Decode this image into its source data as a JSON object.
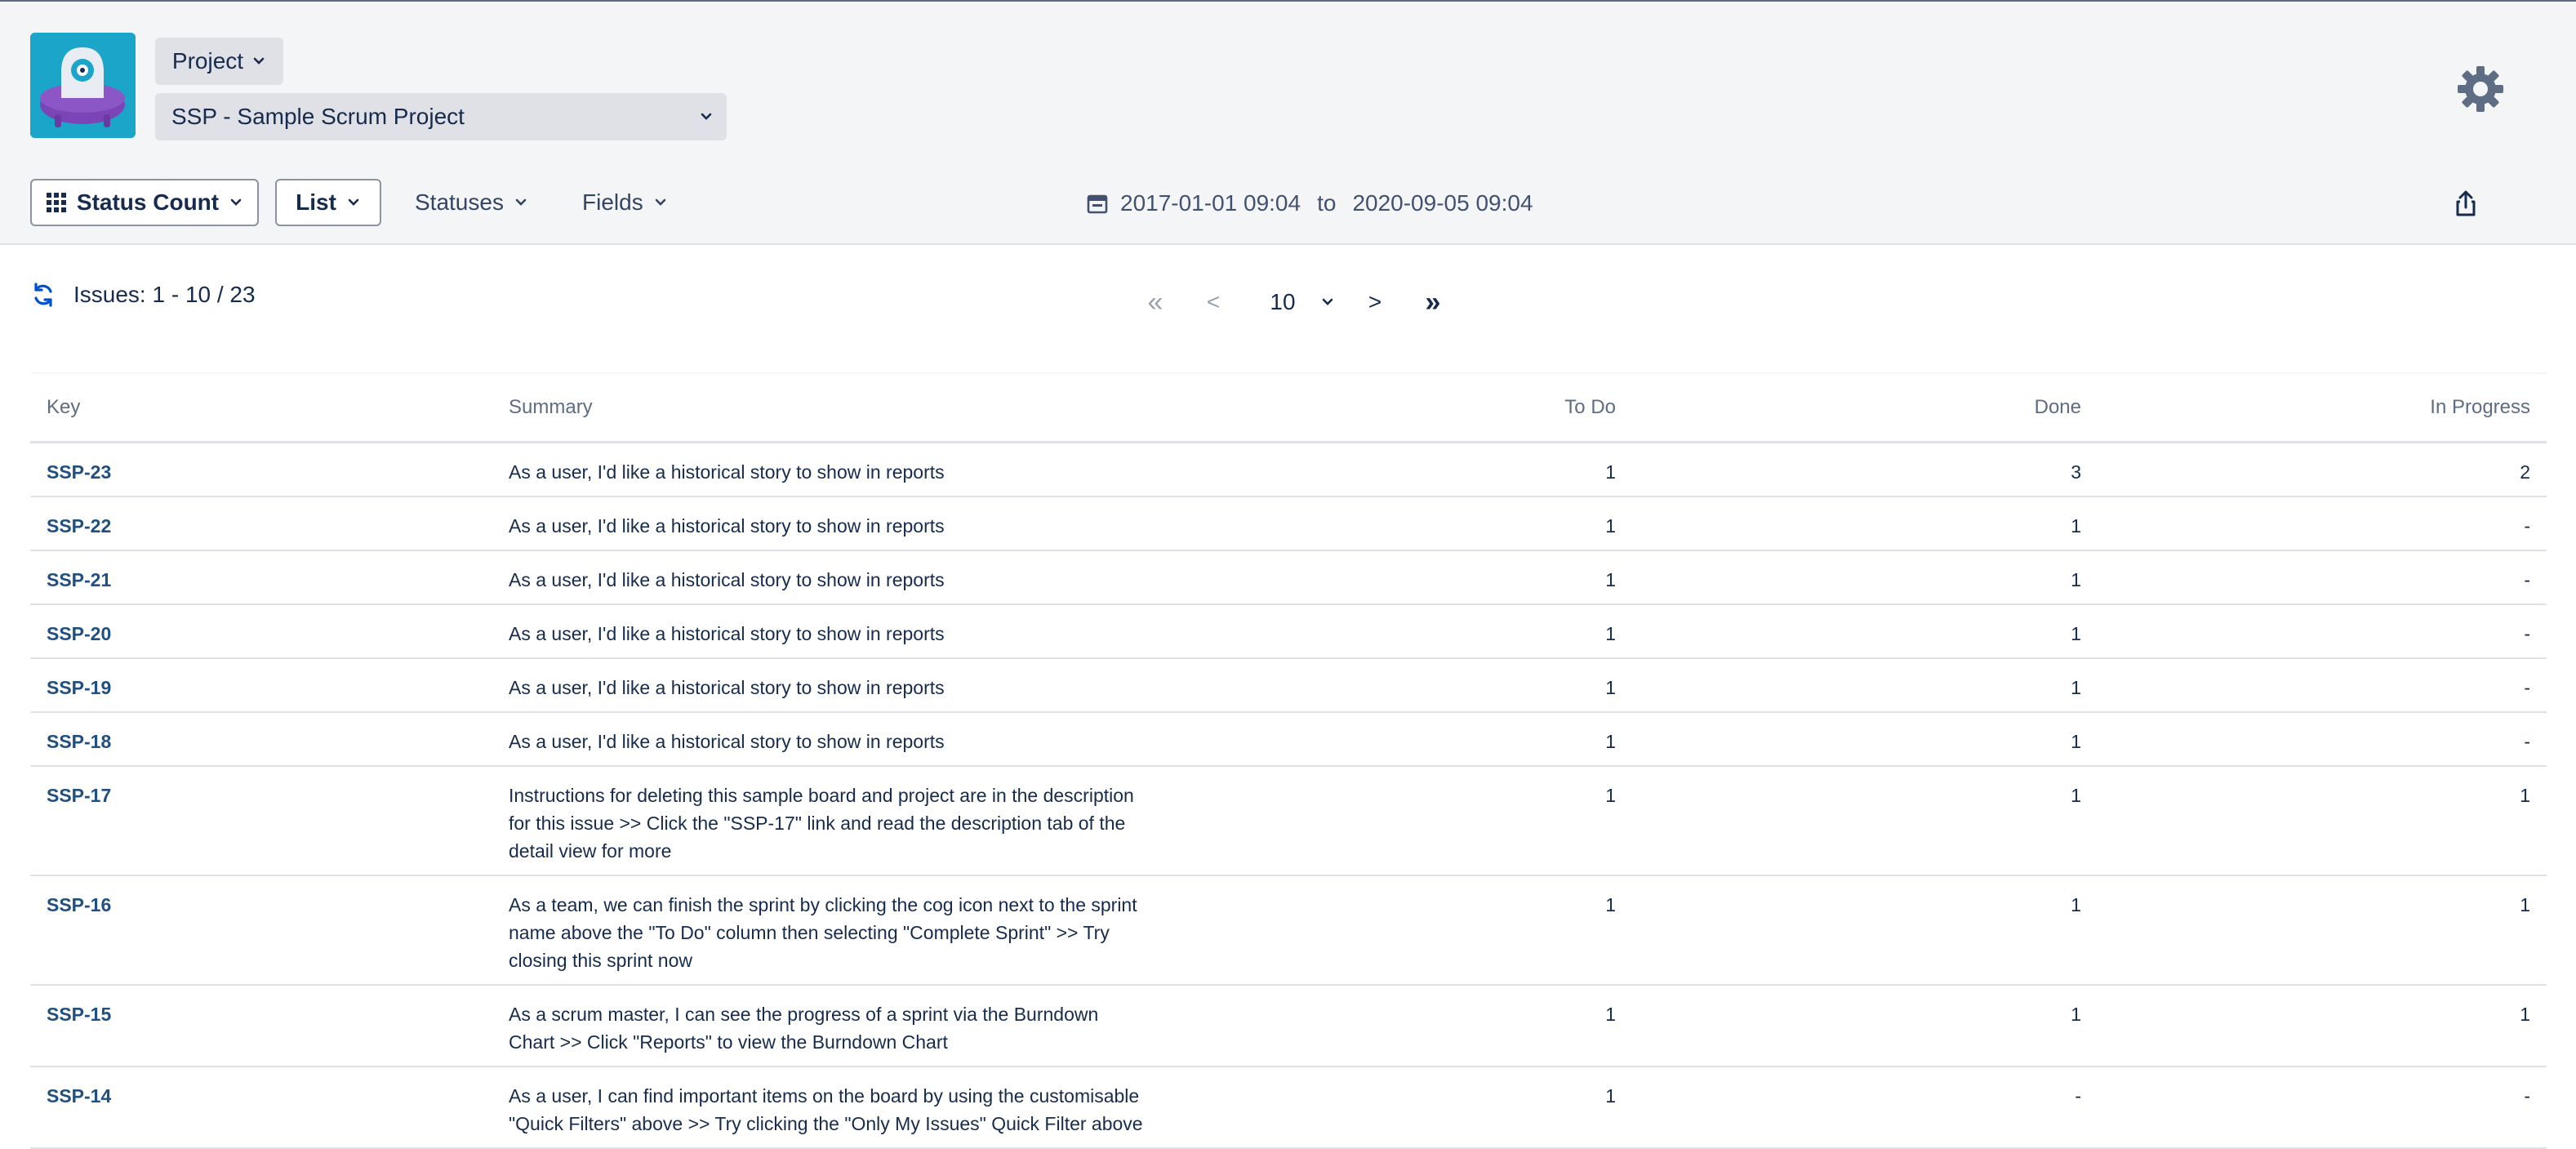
{
  "header": {
    "project_type_label": "Project",
    "project_selected": "SSP - Sample Scrum Project"
  },
  "toolbar": {
    "report_label": "Status Count",
    "view_label": "List",
    "statuses_label": "Statuses",
    "fields_label": "Fields",
    "date_from": "2017-01-01 09:04",
    "date_to_word": "to",
    "date_to": "2020-09-05 09:04"
  },
  "results": {
    "issues_count": "Issues: 1 - 10 / 23"
  },
  "pagination": {
    "first": "«",
    "prev": "<",
    "page_size": "10",
    "next": ">",
    "last": "»"
  },
  "table": {
    "columns": [
      "Key",
      "Summary",
      "To Do",
      "Done",
      "In Progress"
    ],
    "rows": [
      {
        "key": "SSP-23",
        "summary": "As a user, I'd like a historical story to show in reports",
        "todo": "1",
        "done": "3",
        "in_progress": "2"
      },
      {
        "key": "SSP-22",
        "summary": "As a user, I'd like a historical story to show in reports",
        "todo": "1",
        "done": "1",
        "in_progress": "-"
      },
      {
        "key": "SSP-21",
        "summary": "As a user, I'd like a historical story to show in reports",
        "todo": "1",
        "done": "1",
        "in_progress": "-"
      },
      {
        "key": "SSP-20",
        "summary": "As a user, I'd like a historical story to show in reports",
        "todo": "1",
        "done": "1",
        "in_progress": "-"
      },
      {
        "key": "SSP-19",
        "summary": "As a user, I'd like a historical story to show in reports",
        "todo": "1",
        "done": "1",
        "in_progress": "-"
      },
      {
        "key": "SSP-18",
        "summary": "As a user, I'd like a historical story to show in reports",
        "todo": "1",
        "done": "1",
        "in_progress": "-"
      },
      {
        "key": "SSP-17",
        "summary": "Instructions for deleting this sample board and project are in the description for this issue >> Click the \"SSP-17\" link and read the description tab of the detail view for more",
        "todo": "1",
        "done": "1",
        "in_progress": "1"
      },
      {
        "key": "SSP-16",
        "summary": "As a team, we can finish the sprint by clicking the cog icon next to the sprint name above the \"To Do\" column then selecting \"Complete Sprint\" >> Try closing this sprint now",
        "todo": "1",
        "done": "1",
        "in_progress": "1"
      },
      {
        "key": "SSP-15",
        "summary": "As a scrum master, I can see the progress of a sprint via the Burndown Chart >> Click \"Reports\" to view the Burndown Chart",
        "todo": "1",
        "done": "1",
        "in_progress": "1"
      },
      {
        "key": "SSP-14",
        "summary": "As a user, I can find important items on the board by using the customisable \"Quick Filters\" above >> Try clicking the \"Only My Issues\" Quick Filter above",
        "todo": "1",
        "done": "-",
        "in_progress": "-"
      }
    ]
  },
  "colors": {
    "header_bg": "#f4f5f7",
    "link": "#205081",
    "refresh_icon": "#0052cc",
    "logo_bg": "#1ba6c9"
  },
  "icons": {
    "logo": "alien-ufo-logo",
    "settings": "gear-icon",
    "export": "share-export-icon",
    "refresh": "refresh-icon",
    "calendar": "calendar-icon",
    "grid": "grid-icon"
  }
}
